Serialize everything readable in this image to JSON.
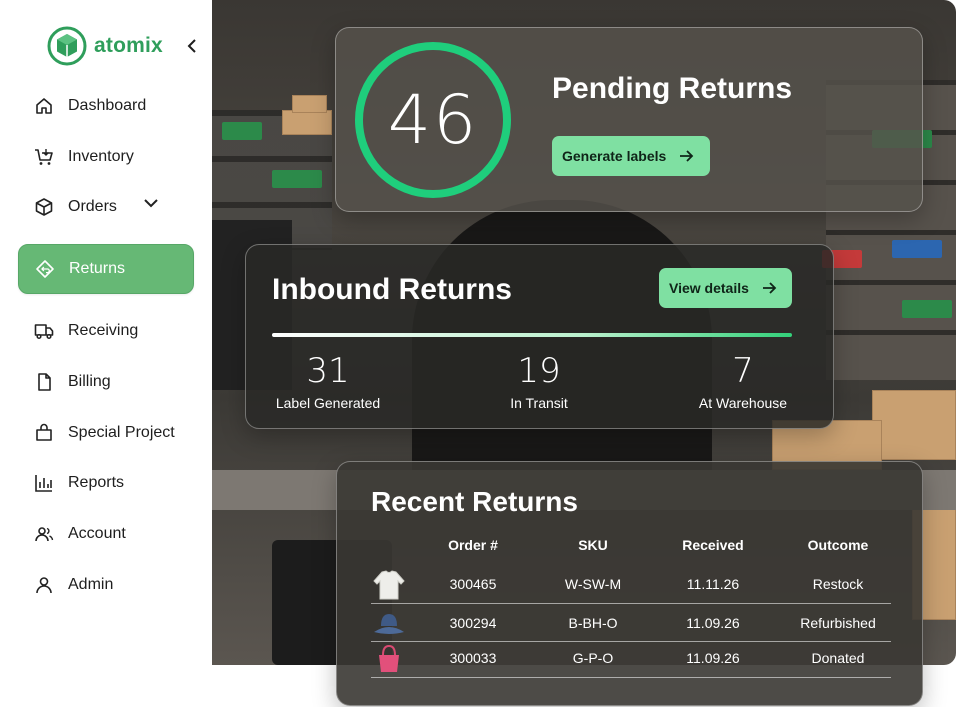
{
  "brand": {
    "name": "atomix",
    "color": "#2f9e5b"
  },
  "sidebar": {
    "items": [
      {
        "label": "Dashboard",
        "icon": "home-icon"
      },
      {
        "label": "Inventory",
        "icon": "cart-icon"
      },
      {
        "label": "Orders",
        "icon": "box-icon",
        "has_dropdown": true
      },
      {
        "label": "Returns",
        "icon": "return-tag-icon",
        "active": true
      },
      {
        "label": "Receiving",
        "icon": "truck-icon"
      },
      {
        "label": "Billing",
        "icon": "file-icon"
      },
      {
        "label": "Special Project",
        "icon": "bag-icon"
      },
      {
        "label": "Reports",
        "icon": "bar-chart-icon"
      },
      {
        "label": "Account",
        "icon": "users-icon"
      },
      {
        "label": "Admin",
        "icon": "user-icon"
      }
    ],
    "active_color": "#66b875"
  },
  "pending": {
    "count": "46",
    "title": "Pending Returns",
    "button_label": "Generate labels"
  },
  "inbound": {
    "title": "Inbound Returns",
    "button_label": "View details",
    "stats": [
      {
        "value": "31",
        "label": "Label Generated"
      },
      {
        "value": "19",
        "label": "In Transit"
      },
      {
        "value": "7",
        "label": "At Warehouse"
      }
    ]
  },
  "recent": {
    "title": "Recent Returns",
    "columns": [
      "Order #",
      "SKU",
      "Received",
      "Outcome"
    ],
    "rows": [
      {
        "item_icon": "sweater-icon",
        "order": "300465",
        "sku": "W-SW-M",
        "received": "11.11.26",
        "outcome": "Restock"
      },
      {
        "item_icon": "bucket-hat-icon",
        "order": "300294",
        "sku": "B-BH-O",
        "received": "11.09.26",
        "outcome": "Refurbished"
      },
      {
        "item_icon": "handbag-icon",
        "order": "300033",
        "sku": "G-P-O",
        "received": "11.09.26",
        "outcome": "Donated"
      }
    ]
  },
  "accent_color": "#7fe0a2"
}
